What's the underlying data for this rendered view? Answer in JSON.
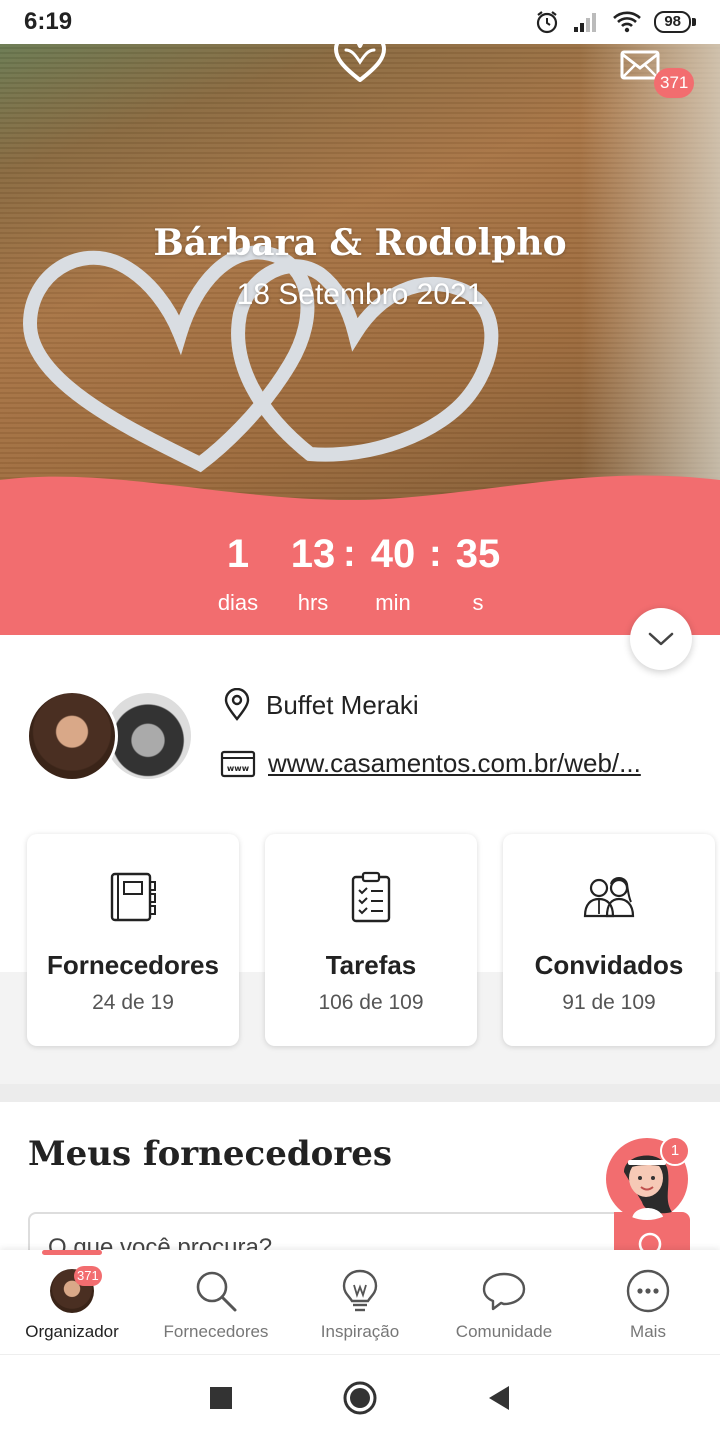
{
  "status_bar": {
    "time": "6:19",
    "battery": "98"
  },
  "header": {
    "couple_name": "Bárbara & Rodolpho",
    "date": "18 Setembro 2021",
    "mail_badge": "371"
  },
  "countdown": {
    "days": "1",
    "days_label": "dias",
    "hours": "13",
    "hours_label": "hrs",
    "minutes": "40",
    "minutes_label": "min",
    "seconds": "35",
    "seconds_label": "s",
    "separator": ":"
  },
  "info": {
    "venue": "Buffet Meraki",
    "website": "www.casamentos.com.br/web/..."
  },
  "cards": [
    {
      "title": "Fornecedores",
      "subtitle": "24 de 19"
    },
    {
      "title": "Tarefas",
      "subtitle": "106 de 109"
    },
    {
      "title": "Convidados",
      "subtitle": "91 de 109"
    }
  ],
  "suppliers": {
    "title": "Meus fornecedores",
    "search_placeholder": "O que você procura?",
    "assistant_badge": "1"
  },
  "bottom_nav": {
    "items": [
      {
        "label": "Organizador",
        "badge": "371"
      },
      {
        "label": "Fornecedores"
      },
      {
        "label": "Inspiração"
      },
      {
        "label": "Comunidade"
      },
      {
        "label": "Mais"
      }
    ]
  },
  "colors": {
    "accent": "#f26d6f"
  }
}
